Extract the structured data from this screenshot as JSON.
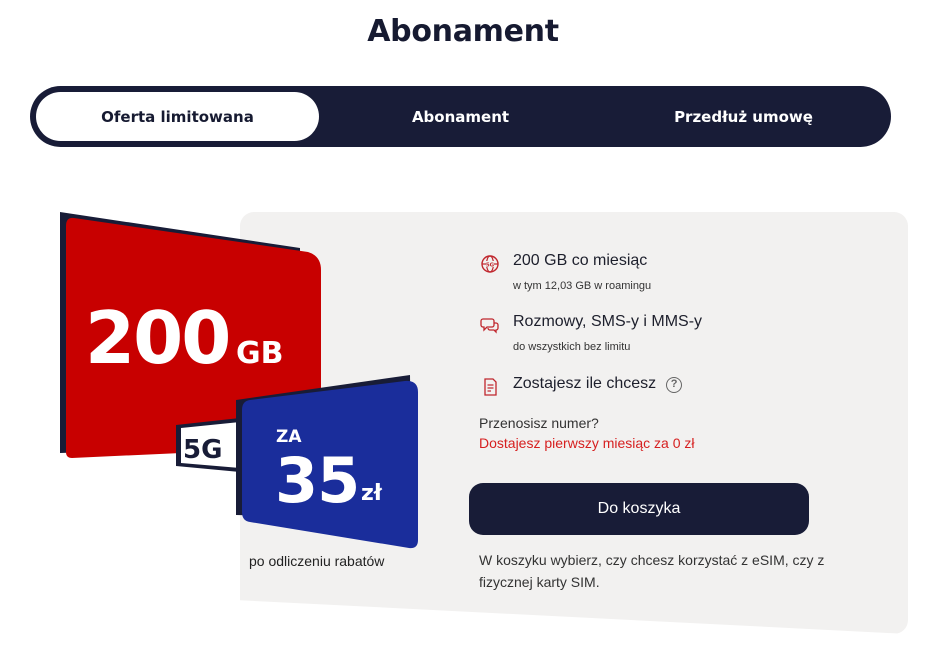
{
  "page": {
    "title": "Abonament"
  },
  "tabs": [
    {
      "label": "Oferta limitowana",
      "active": true
    },
    {
      "label": "Abonament",
      "active": false
    },
    {
      "label": "Przedłuż umowę",
      "active": false
    }
  ],
  "promo": {
    "data_amount": "200",
    "data_unit": "GB",
    "network": "5G",
    "price_prefix": "ZA",
    "price": "35",
    "currency": "zł",
    "note": "po odliczeniu rabatów",
    "colors": {
      "red_card": "#c80000",
      "blue_card": "#1a2d9b",
      "dark": "#181c37"
    }
  },
  "features": [
    {
      "icon": "globe-5g-icon",
      "title": "200 GB co miesiąc",
      "subtitle": "w tym 12,03 GB w roamingu"
    },
    {
      "icon": "chat-bubbles-icon",
      "title": "Rozmowy, SMS-y i MMS-y",
      "subtitle": "do wszystkich bez limitu"
    },
    {
      "icon": "document-icon",
      "title": "Zostajesz ile chcesz",
      "subtitle": ""
    }
  ],
  "porting": {
    "question": "Przenosisz numer?",
    "offer": "Dostajesz pierwszy miesiąc za 0 zł"
  },
  "cart": {
    "button_label": "Do koszyka",
    "note": "W koszyku wybierz, czy chcesz korzystać z eSIM, czy z fizycznej karty SIM."
  },
  "colors": {
    "accent_red": "#d61f1f",
    "navy": "#181c37",
    "card_bg": "#f2f1f0"
  }
}
